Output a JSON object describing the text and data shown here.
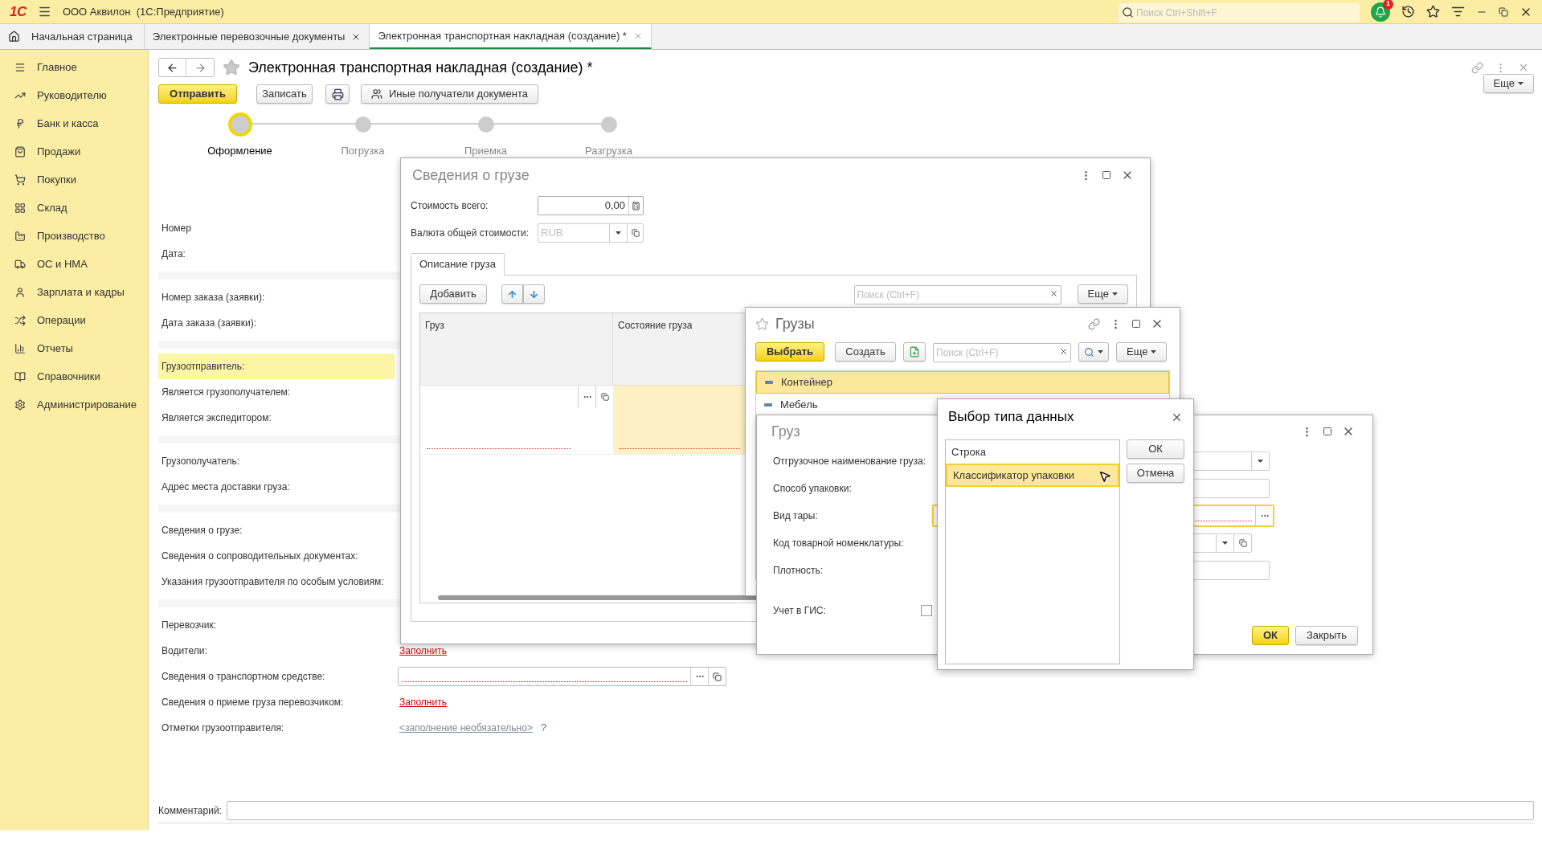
{
  "app_bar": {
    "logo": "1С",
    "title": "ООО Аквилон  (1С:Предприятие)",
    "search": {
      "placeholder": "Поиск Ctrl+Shift+F"
    },
    "notifications": "1"
  },
  "tabs": [
    {
      "label": "Начальная страница",
      "kind": "home",
      "selected": false
    },
    {
      "label": "Электронные перевозочные документы",
      "kind": "closable",
      "selected": false
    },
    {
      "label": "Электронная транспортная накладная (создание) *",
      "kind": "closable",
      "selected": true
    }
  ],
  "sidebar": {
    "items": [
      {
        "label": "Главное",
        "kind": "menu"
      },
      {
        "label": "Руководителю",
        "kind": "trend"
      },
      {
        "label": "Банк и касса",
        "kind": "ruble"
      },
      {
        "label": "Продажи",
        "kind": "bag"
      },
      {
        "label": "Покупки",
        "kind": "cart"
      },
      {
        "label": "Склад",
        "kind": "grid"
      },
      {
        "label": "Производство",
        "kind": "factory"
      },
      {
        "label": "ОС и НМА",
        "kind": "truck"
      },
      {
        "label": "Зарплата и кадры",
        "kind": "person"
      },
      {
        "label": "Операции",
        "kind": "ops"
      },
      {
        "label": "Отчеты",
        "kind": "chart"
      },
      {
        "label": "Справочники",
        "kind": "book"
      },
      {
        "label": "Администрирование",
        "kind": "gear"
      }
    ]
  },
  "document": {
    "title": "Электронная транспортная накладная (создание) *",
    "more": "Еще",
    "buttons": [
      {
        "label": "Отправить",
        "kind": "primary"
      },
      {
        "label": "Записать",
        "kind": "default"
      },
      {
        "kind": "print"
      },
      {
        "label": "Иные получатели документа",
        "kind": "recipients"
      }
    ],
    "steps": [
      {
        "label": "Оформление",
        "selected": true
      },
      {
        "label": "Погрузка",
        "selected": false
      },
      {
        "label": "Приемка",
        "selected": false
      },
      {
        "label": "Разгрузка",
        "selected": false
      }
    ],
    "groups": [
      [
        {
          "label": "Номер",
          "kind": "label",
          "highlighted": false
        },
        {
          "label": "Дата:",
          "kind": "label",
          "highlighted": false
        }
      ],
      [
        {
          "label": "Номер заказа (заявки):",
          "kind": "label",
          "highlighted": false
        },
        {
          "label": "Дата заказа (заявки):",
          "kind": "label",
          "highlighted": false
        }
      ],
      [
        {
          "label": "Грузоотправитель:",
          "kind": "label",
          "highlighted": true
        },
        {
          "label": "Является грузополучателем:",
          "kind": "label",
          "highlighted": false
        },
        {
          "label": "Является экспедитором:",
          "kind": "label",
          "highlighted": false
        }
      ],
      [
        {
          "label": "Грузополучатель:",
          "kind": "label",
          "highlighted": false
        },
        {
          "label": "Адрес места доставки груза:",
          "kind": "label",
          "highlighted": false
        }
      ],
      [
        {
          "label": "Сведения о грузе:",
          "kind": "label",
          "highlighted": false
        },
        {
          "label": "Сведения о сопроводительных документах:",
          "kind": "label",
          "highlighted": false
        },
        {
          "label": "Указания грузоотправителя по особым условиям:",
          "kind": "label",
          "highlighted": false
        }
      ],
      [
        {
          "label": "Перевозчик:",
          "kind": "label",
          "highlighted": false
        },
        {
          "label": "Водители:",
          "kind": "link",
          "value": "Заполнить",
          "highlighted": false
        },
        {
          "label": "Сведения о транспортном средстве:",
          "kind": "input",
          "highlighted": false
        },
        {
          "label": "Сведения о приеме груза перевозчиком:",
          "kind": "link",
          "value": "Заполнить",
          "highlighted": false
        },
        {
          "label": "Отметки грузоотправителя:",
          "kind": "optional",
          "value": "<заполнение необязательно>",
          "help": "?",
          "highlighted": false
        }
      ]
    ],
    "comment": {
      "label": "Комментарий:"
    }
  },
  "cargo_info_dialog": {
    "title": "Сведения о грузе",
    "total_label": "Стоимость всего:",
    "total_value": "0,00",
    "currency_label": "Валюта общей стоимости:",
    "currency_value": "RUB",
    "tab": "Описание груза",
    "add": "Добавить",
    "search": {
      "placeholder": "Поиск (Ctrl+F)"
    },
    "more": "Еще",
    "columns": [
      "Груз",
      "Состояние груза"
    ]
  },
  "cargo_list_dialog": {
    "title": "Грузы",
    "select": "Выбрать",
    "create": "Создать",
    "search": {
      "placeholder": "Поиск (Ctrl+F)"
    },
    "more": "Еще",
    "items": [
      {
        "label": "Контейнер",
        "selected": true
      },
      {
        "label": "Мебель",
        "selected": false
      }
    ]
  },
  "cargo_dialog": {
    "title": "Груз",
    "fields": [
      {
        "label": "Отгрузочное наименование груза:",
        "kind": "dropdown"
      },
      {
        "label": "Способ упаковки:",
        "kind": "text"
      },
      {
        "label": "Вид тары:",
        "kind": "choice"
      },
      {
        "label": "Код товарной номенклатуры:",
        "kind": "dropdown"
      },
      {
        "label": "Плотность:",
        "kind": "text"
      },
      {
        "label": "Учет в ГИС:",
        "kind": "check",
        "checked": false
      }
    ],
    "ok": "ОК",
    "close": "Закрыть"
  },
  "type_dialog": {
    "title": "Выбор типа данных",
    "items": [
      {
        "label": "Строка",
        "selected": false
      },
      {
        "label": "Классификатор упаковки",
        "selected": true
      }
    ],
    "ok": "ОК",
    "cancel": "Отмена"
  }
}
